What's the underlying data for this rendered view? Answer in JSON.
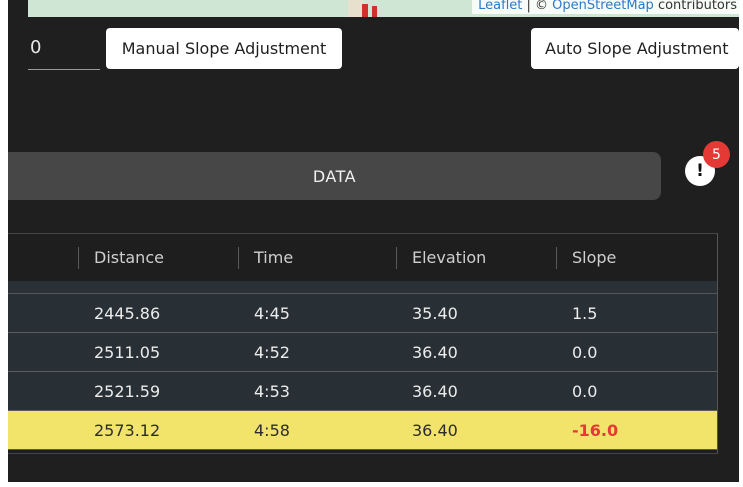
{
  "map": {
    "attribution_leaflet": "Leaflet",
    "attribution_sep": " | © ",
    "attribution_osm": "OpenStreetMap",
    "attribution_suffix": " contributors"
  },
  "controls": {
    "slope_value": "0",
    "manual_label": "Manual Slope Adjustment",
    "auto_label": "Auto Slope Adjustment"
  },
  "tab": {
    "data_label": "DATA"
  },
  "alerts": {
    "icon": "!",
    "count": "5"
  },
  "table": {
    "headers": [
      "Distance",
      "Time",
      "Elevation",
      "Slope"
    ],
    "rows": [
      {
        "distance": "2445.86",
        "time": "4:45",
        "elevation": "35.40",
        "slope": "1.5"
      },
      {
        "distance": "2511.05",
        "time": "4:52",
        "elevation": "36.40",
        "slope": "0.0"
      },
      {
        "distance": "2521.59",
        "time": "4:53",
        "elevation": "36.40",
        "slope": "0.0"
      },
      {
        "distance": "2573.12",
        "time": "4:58",
        "elevation": "36.40",
        "slope": "-16.0"
      }
    ]
  },
  "colors": {
    "highlight_row": "#f2e46b",
    "negative_slope": "#e53935",
    "badge": "#e53935"
  }
}
